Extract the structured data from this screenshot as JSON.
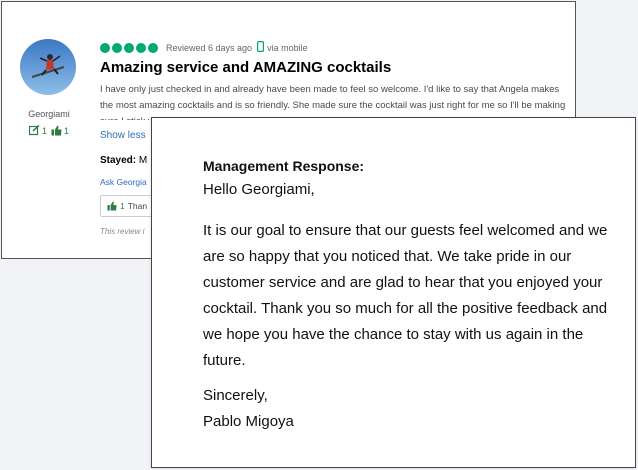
{
  "review": {
    "reviewer_name": "Georgiami",
    "contributions_count": "1",
    "helpful_votes_count": "1",
    "review_date": "Reviewed 6 days ago",
    "via": "via mobile",
    "title": "Amazing service and AMAZING cocktails",
    "body": "I have only just checked in and already have been made to feel so welcome. I'd like to say that Angela makes the most amazing cocktails and is so friendly. She made sure the cocktail was just right for me so I'll be making sure I stick with her for the rest of my time here! Yes.",
    "show_less": "Show less",
    "stayed_label": "Stayed:",
    "stayed_value": "M",
    "ask_link": "Ask Georgia",
    "helpful_count": "1",
    "helpful_label": "Than",
    "disclaimer": "This review i",
    "rating_bubbles": 5,
    "accent_color": "#00aa6c"
  },
  "response": {
    "heading": "Management Response:",
    "greeting": "Hello Georgiami,",
    "body": "It is our goal to ensure that our guests feel welcomed and we are so happy that you noticed that. We take pride in our customer service and are glad to hear that you enjoyed your cocktail. Thank you so much for all the positive feedback and we hope you have the chance to stay with us again in the future.",
    "closing": "Sincerely,",
    "signature": "Pablo Migoya"
  }
}
